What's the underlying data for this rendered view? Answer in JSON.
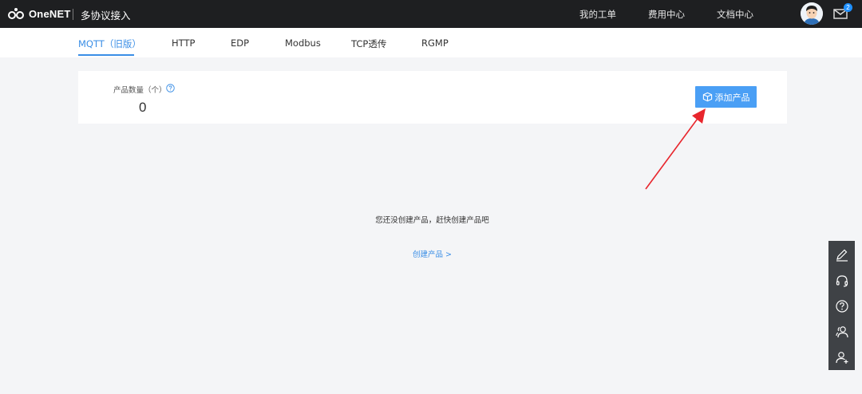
{
  "topbar": {
    "logo_text": "OneNET",
    "page_name": "多协议接入",
    "nav": [
      "我的工单",
      "费用中心",
      "文档中心"
    ],
    "mail_badge": "2"
  },
  "tabs": [
    {
      "label": "MQTT（旧版）",
      "active": true
    },
    {
      "label": "HTTP",
      "active": false
    },
    {
      "label": "EDP",
      "active": false
    },
    {
      "label": "Modbus",
      "active": false
    },
    {
      "label": "TCP透传",
      "active": false
    },
    {
      "label": "RGMP",
      "active": false
    }
  ],
  "summary": {
    "count_label": "产品数量（个）",
    "count_value": "0",
    "add_button_label": "添加产品"
  },
  "empty_state": {
    "message": "您还没创建产品，赶快创建产品吧",
    "link_label": "创建产品 >"
  },
  "colors": {
    "accent": "#3a8ee6",
    "button": "#4a9ff5",
    "topbar": "#1e1f21",
    "annotation_arrow": "#e8262d"
  },
  "side_tools": [
    "edit-icon",
    "headset-icon",
    "help-icon",
    "community-icon",
    "add-user-icon"
  ]
}
